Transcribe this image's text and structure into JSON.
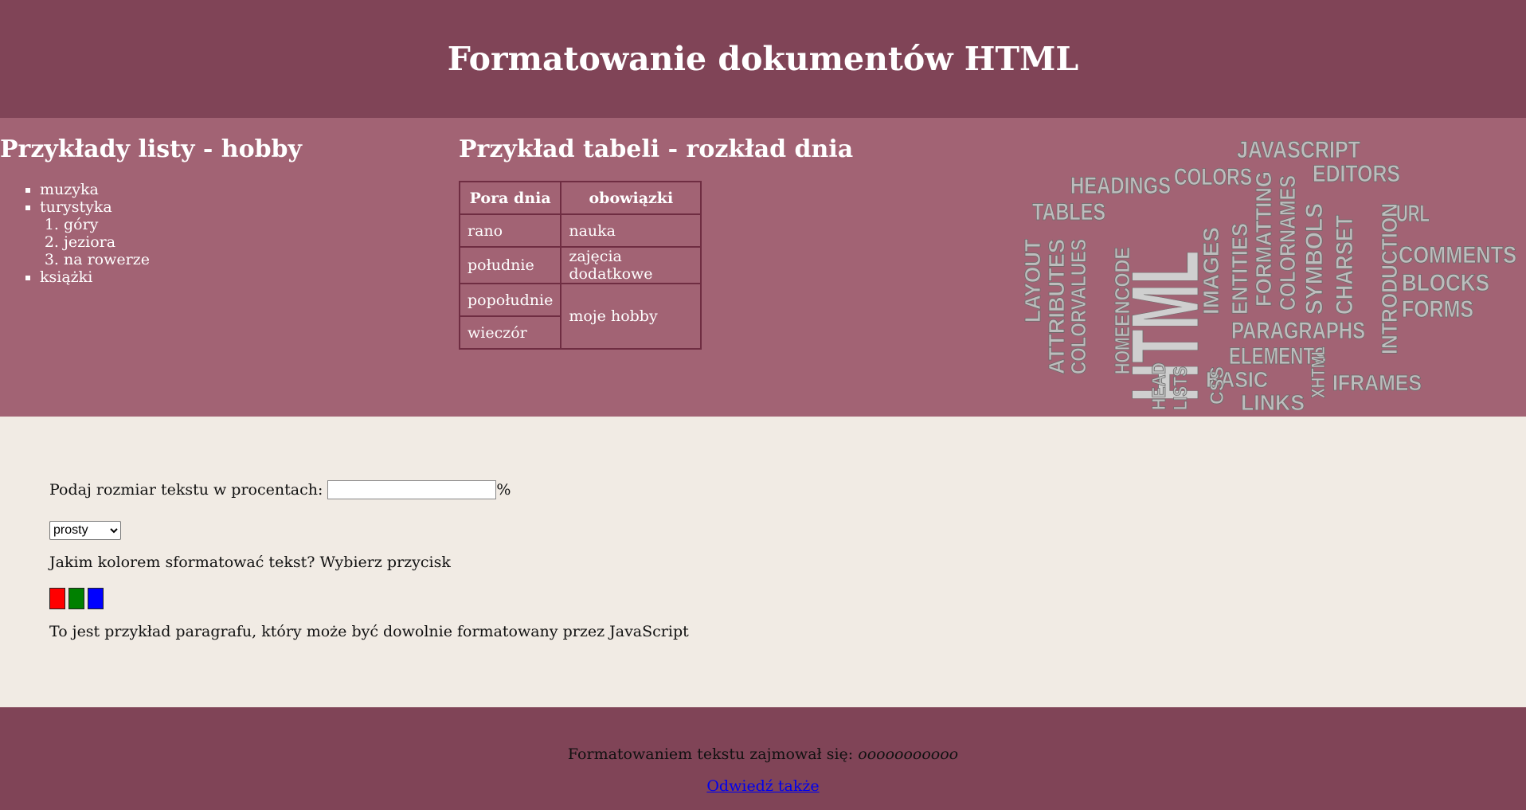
{
  "header": {
    "title": "Formatowanie dokumentów HTML"
  },
  "list_section": {
    "title": "Przykłady listy - hobby",
    "items": [
      "muzyka",
      "turystyka",
      "książki"
    ],
    "sub_items": [
      "góry",
      "jeziora",
      "na rowerze"
    ]
  },
  "table_section": {
    "title": "Przykład tabeli - rozkład dnia",
    "headers": [
      "Pora dnia",
      "obowiązki"
    ],
    "rows": [
      [
        "rano",
        "nauka"
      ],
      [
        "południe",
        "zajęcia dodatkowe"
      ],
      [
        "popołudnie",
        "moje hobby"
      ],
      [
        "wieczór",
        ""
      ]
    ]
  },
  "word_cloud": {
    "words": [
      "JAVASCRIPT",
      "HEADINGS",
      "COLORS",
      "EDITORS",
      "TABLES",
      "HTML",
      "URL",
      "FORMATTING",
      "COLORNAMES",
      "SYMBOLS",
      "CHARSET",
      "INTRODUCTION",
      "COMMENTS",
      "BLOCKS",
      "FORMS",
      "LAYOUT",
      "ATTRIBUTES",
      "COLORVALUES",
      "ENCODE",
      "IMAGES",
      "ENTITIES",
      "PARAGRAPHS",
      "ELEMENTS",
      "HOME",
      "BASIC",
      "IFRAMES",
      "LINKS",
      "HEAD",
      "LISTS",
      "CSS",
      "XHTML"
    ]
  },
  "form": {
    "size_label": "Podaj rozmiar tekstu w procentach:",
    "size_value": "",
    "percent_sign": "%",
    "style_selected": "prosty",
    "color_question": "Jakim kolorem sformatować tekst? Wybierz przycisk",
    "color_buttons": [
      {
        "name": "red",
        "color": "#ff0000"
      },
      {
        "name": "green",
        "color": "#008000"
      },
      {
        "name": "blue",
        "color": "#0000ff"
      }
    ],
    "paragraph": "To jest przykład paragrafu, który może być dowolnie formatowany przez JavaScript"
  },
  "footer": {
    "author_label": "Formatowaniem tekstu zajmował się:",
    "author_name": "ooooooooooo",
    "link_text": "Odwiedź także"
  },
  "colors": {
    "header_bg": "#804457",
    "middle_bg": "#a26374",
    "form_bg": "#f1ebe4",
    "footer_bg": "#804457",
    "table_border": "#6f2d42"
  }
}
